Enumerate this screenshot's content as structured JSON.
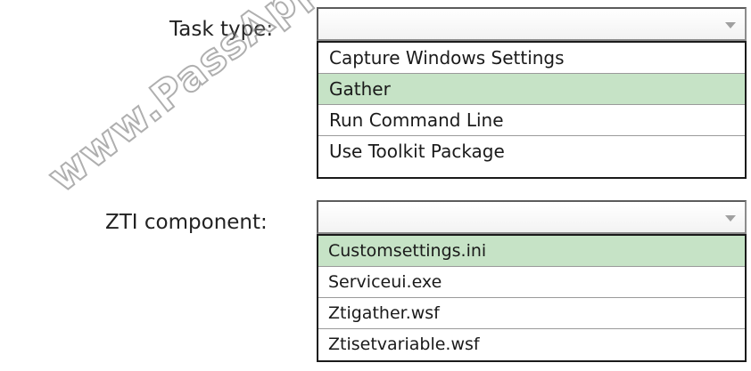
{
  "task_type": {
    "label": "Task type:",
    "selected_value": "",
    "options": [
      {
        "label": "Capture Windows Settings",
        "selected": false
      },
      {
        "label": "Gather",
        "selected": true
      },
      {
        "label": "Run Command Line",
        "selected": false
      },
      {
        "label": "Use Toolkit Package",
        "selected": false
      }
    ]
  },
  "zti_component": {
    "label": "ZTI component:",
    "selected_value": "",
    "options": [
      {
        "label": "Customsettings.ini",
        "selected": true
      },
      {
        "label": "Serviceui.exe",
        "selected": false
      },
      {
        "label": "Ztigather.wsf",
        "selected": false
      },
      {
        "label": "Ztisetvariable.wsf",
        "selected": false
      }
    ]
  },
  "watermark": {
    "text": "www.PassApply.com"
  },
  "colors": {
    "selected_highlight": "#c6e3c6",
    "border": "#1a1a1a"
  }
}
